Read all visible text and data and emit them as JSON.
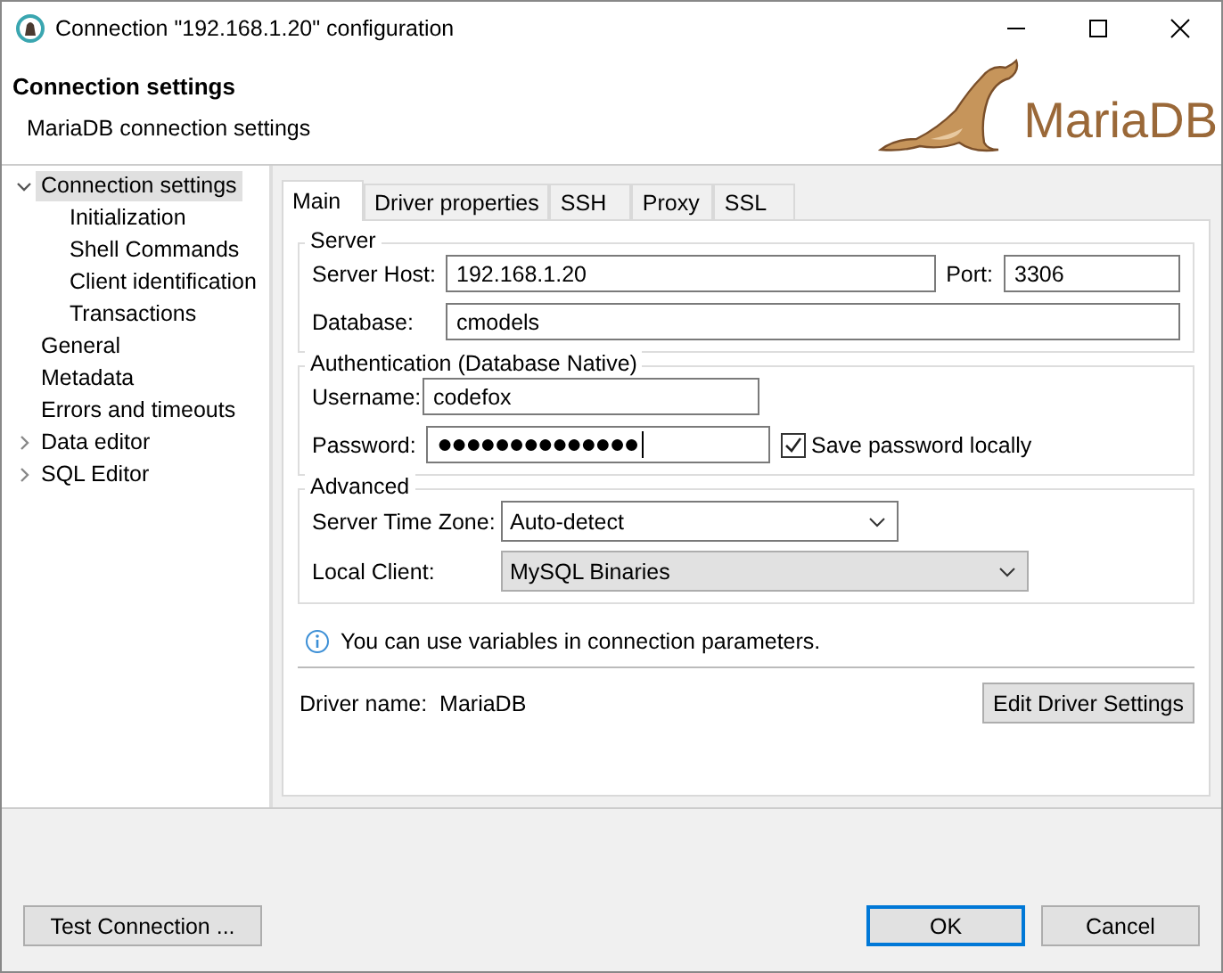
{
  "window": {
    "title": "Connection \"192.168.1.20\" configuration"
  },
  "header": {
    "title": "Connection settings",
    "subtitle": "MariaDB connection settings",
    "logo_text": "MariaDB"
  },
  "sidebar": {
    "items": [
      {
        "label": "Connection settings",
        "selected": true,
        "expanded": true,
        "children": [
          {
            "label": "Initialization",
            "selected": false
          },
          {
            "label": "Shell Commands",
            "selected": false
          },
          {
            "label": "Client identification",
            "selected": false
          },
          {
            "label": "Transactions",
            "selected": false
          }
        ]
      },
      {
        "label": "General",
        "selected": false
      },
      {
        "label": "Metadata",
        "selected": false
      },
      {
        "label": "Errors and timeouts",
        "selected": false
      },
      {
        "label": "Data editor",
        "selected": false,
        "expanded": false
      },
      {
        "label": "SQL Editor",
        "selected": false,
        "expanded": false
      }
    ]
  },
  "tabs": [
    {
      "label": "Main",
      "selected": true
    },
    {
      "label": "Driver properties",
      "selected": false
    },
    {
      "label": "SSH",
      "selected": false
    },
    {
      "label": "Proxy",
      "selected": false
    },
    {
      "label": "SSL",
      "selected": false
    }
  ],
  "server": {
    "legend": "Server",
    "host_label": "Server Host:",
    "host": "192.168.1.20",
    "port_label": "Port:",
    "port": "3306",
    "database_label": "Database:",
    "database": "cmodels"
  },
  "authentication": {
    "legend": "Authentication (Database Native)",
    "username_label": "Username:",
    "username": "codefox",
    "password_label": "Password:",
    "password": "●●●●●●●●●●●●●●",
    "save_password": {
      "label": "Save password locally",
      "checked": true
    }
  },
  "advanced": {
    "legend": "Advanced",
    "fields": [
      {
        "label": "Server Time Zone:",
        "value": "Auto-detect",
        "readonly": false
      },
      {
        "label": "Local Client:",
        "value": "MySQL Binaries",
        "readonly": true
      }
    ]
  },
  "info": "You can use variables in connection parameters.",
  "driver": {
    "label": "Driver name:",
    "name": "MariaDB",
    "button": "Edit Driver Settings"
  },
  "buttons": [
    {
      "label": "Test Connection ...",
      "default": false
    },
    {
      "label": "OK",
      "default": true
    },
    {
      "label": "Cancel",
      "default": false
    }
  ]
}
